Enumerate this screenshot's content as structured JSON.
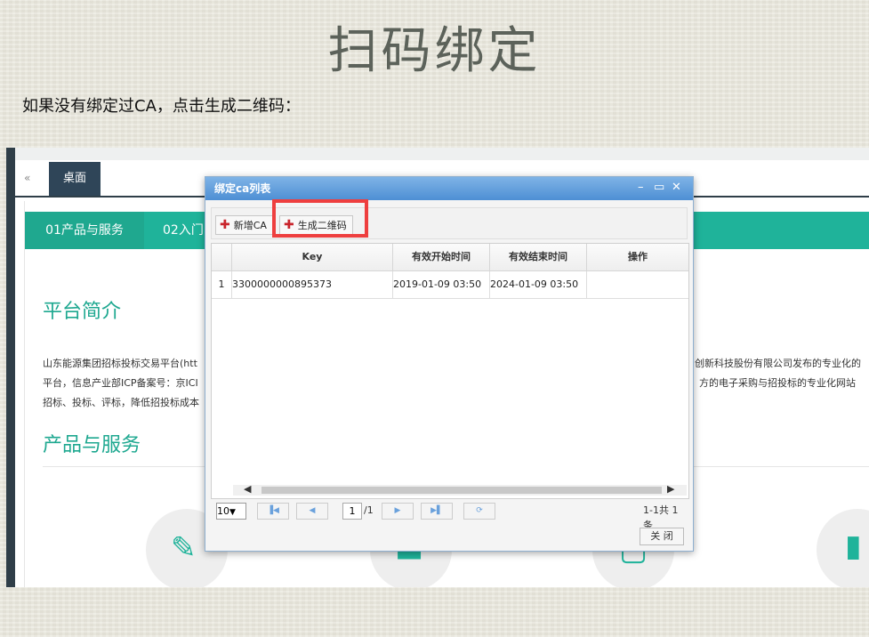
{
  "slide": {
    "title": "扫码绑定",
    "caption": "如果没有绑定过CA，点击生成二维码："
  },
  "app": {
    "back_icon": "«",
    "tab_desktop": "桌面",
    "product_tabs": [
      "01产品与服务",
      "02入门"
    ],
    "section_intro": "平台简介",
    "intro_lines_left": [
      "山东能源集团招标投标交易平台(htt",
      "平台，信息产业部ICP备案号：京ICI",
      "招标、投标、评标，降低招投标成本"
    ],
    "intro_lines_right": [
      "创新科技股份有限公司发布的专业化的",
      "方的电子采购与招投标的专业化网站"
    ],
    "section_products": "产品与服务"
  },
  "dialog": {
    "title": "绑定ca列表",
    "controls": {
      "minimize": "–",
      "maximize": "▭",
      "close": "✕"
    },
    "toolbar": {
      "add_ca": "新增CA",
      "gen_qr": "生成二维码"
    },
    "columns": [
      "Key",
      "有效开始时间",
      "有效结束时间",
      "操作"
    ],
    "rows": [
      {
        "index": "1",
        "key": "3300000000895373",
        "start": "2019-01-09 03:50",
        "end": "2024-01-09 03:50",
        "op": ""
      }
    ],
    "pager": {
      "page_size": "10",
      "page_input": "1",
      "page_total": "/1",
      "summary": "1-1共 1条"
    },
    "close_label": "关 闭"
  },
  "colors": {
    "accent_green": "#1fb39a",
    "dialog_header": "#4d8fd4",
    "highlight_red": "#ee3f3f"
  }
}
